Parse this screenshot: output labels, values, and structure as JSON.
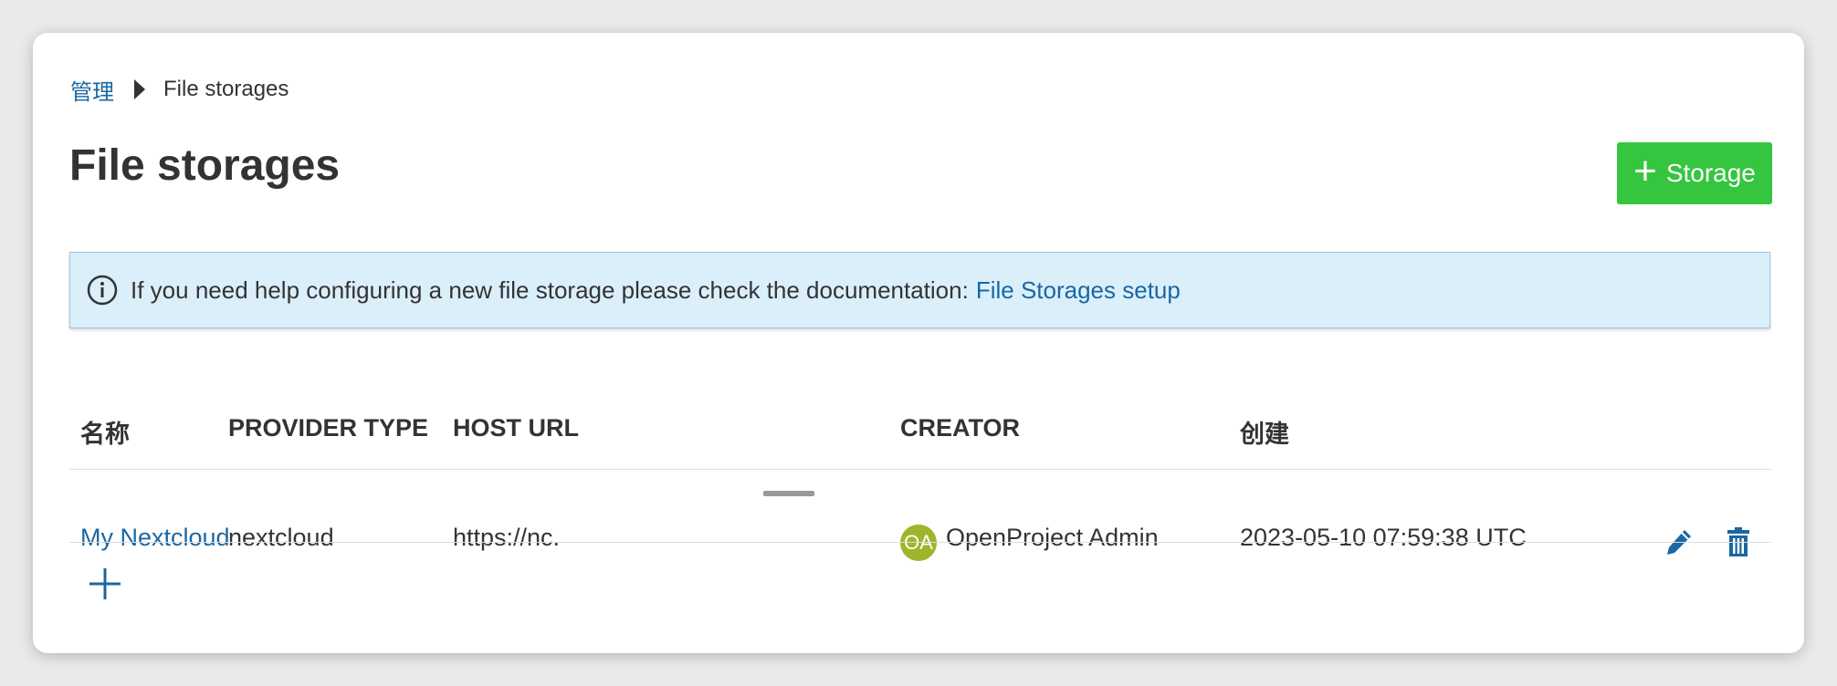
{
  "breadcrumb": {
    "parent": "管理",
    "current": "File storages"
  },
  "page": {
    "title": "File storages"
  },
  "toolbar": {
    "add_label": "Storage",
    "add_icon": "plus-icon",
    "accent": "#35c53f"
  },
  "notice": {
    "icon": "info-icon",
    "text": "If you need help configuring a new file storage please check the documentation:",
    "link_text": "File Storages setup"
  },
  "table": {
    "headers": {
      "name": "名称",
      "provider_type": "PROVIDER TYPE",
      "host_url": "HOST URL",
      "creator": "CREATOR",
      "created": "创建"
    },
    "rows": [
      {
        "name": "My Nextcloud",
        "provider_type": "nextcloud",
        "host_url": "https://nc.",
        "creator_initials": "OA",
        "creator": "OpenProject Admin",
        "created": "2023-05-10 07:59:38 UTC"
      }
    ]
  },
  "colors": {
    "link": "#1a67a3",
    "notice_bg": "#dbeffb",
    "avatar": "#9eb52c"
  }
}
